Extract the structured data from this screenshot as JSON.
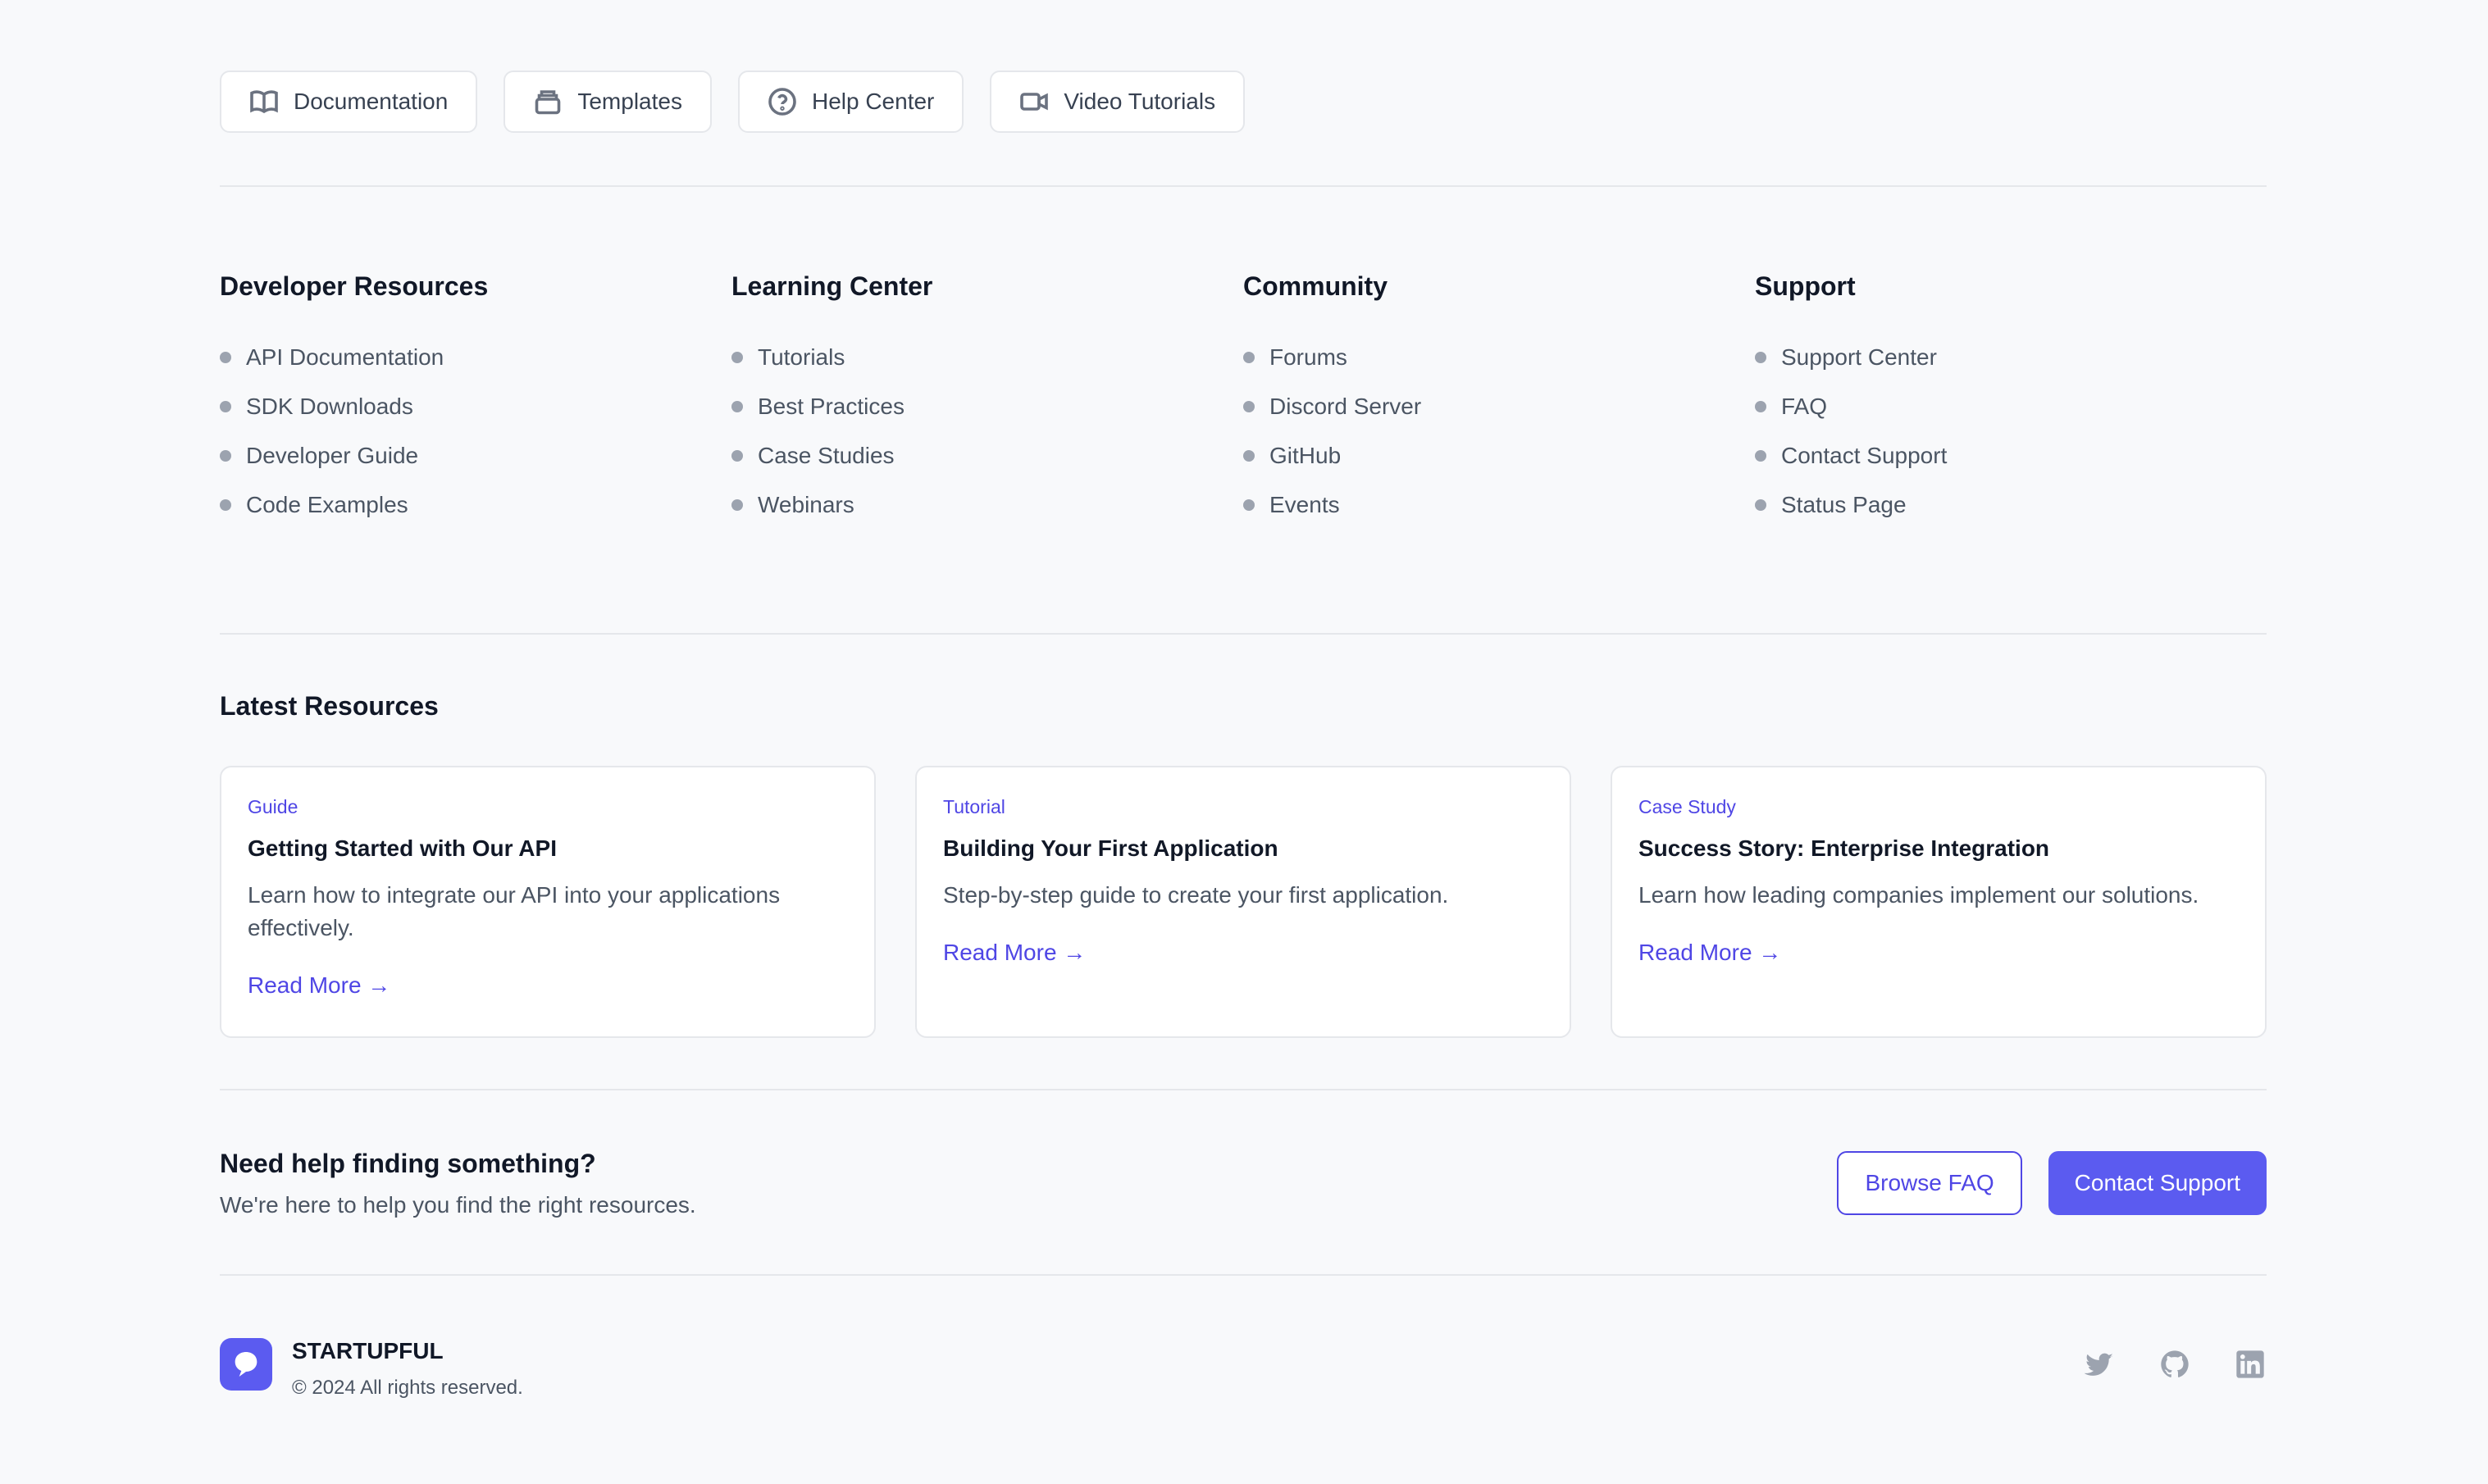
{
  "quick_links": [
    {
      "label": "Documentation",
      "icon": "book-icon"
    },
    {
      "label": "Templates",
      "icon": "layers-icon"
    },
    {
      "label": "Help Center",
      "icon": "help-circle-icon"
    },
    {
      "label": "Video Tutorials",
      "icon": "video-icon"
    }
  ],
  "columns": [
    {
      "heading": "Developer Resources",
      "items": [
        "API Documentation",
        "SDK Downloads",
        "Developer Guide",
        "Code Examples"
      ]
    },
    {
      "heading": "Learning Center",
      "items": [
        "Tutorials",
        "Best Practices",
        "Case Studies",
        "Webinars"
      ]
    },
    {
      "heading": "Community",
      "items": [
        "Forums",
        "Discord Server",
        "GitHub",
        "Events"
      ]
    },
    {
      "heading": "Support",
      "items": [
        "Support Center",
        "FAQ",
        "Contact Support",
        "Status Page"
      ]
    }
  ],
  "latest": {
    "title": "Latest Resources",
    "cards": [
      {
        "tag": "Guide",
        "title": "Getting Started with Our API",
        "desc": "Learn how to integrate our API into your applications effectively.",
        "link": "Read More →"
      },
      {
        "tag": "Tutorial",
        "title": "Building Your First Application",
        "desc": "Step-by-step guide to create your first application.",
        "link": "Read More →"
      },
      {
        "tag": "Case Study",
        "title": "Success Story: Enterprise Integration",
        "desc": "Learn how leading companies implement our solutions.",
        "link": "Read More →"
      }
    ]
  },
  "help": {
    "title": "Need help finding something?",
    "subtitle": "We're here to help you find the right resources.",
    "browse_label": "Browse FAQ",
    "contact_label": "Contact Support"
  },
  "footer": {
    "brand": "STARTUPFUL",
    "copyright": "© 2024 All rights reserved.",
    "socials": [
      "twitter-icon",
      "github-icon",
      "linkedin-icon"
    ]
  },
  "colors": {
    "accent": "#5b5bf0",
    "accent_text": "#4f46e5",
    "background": "#f8f9fb",
    "muted": "#9ca3af"
  }
}
